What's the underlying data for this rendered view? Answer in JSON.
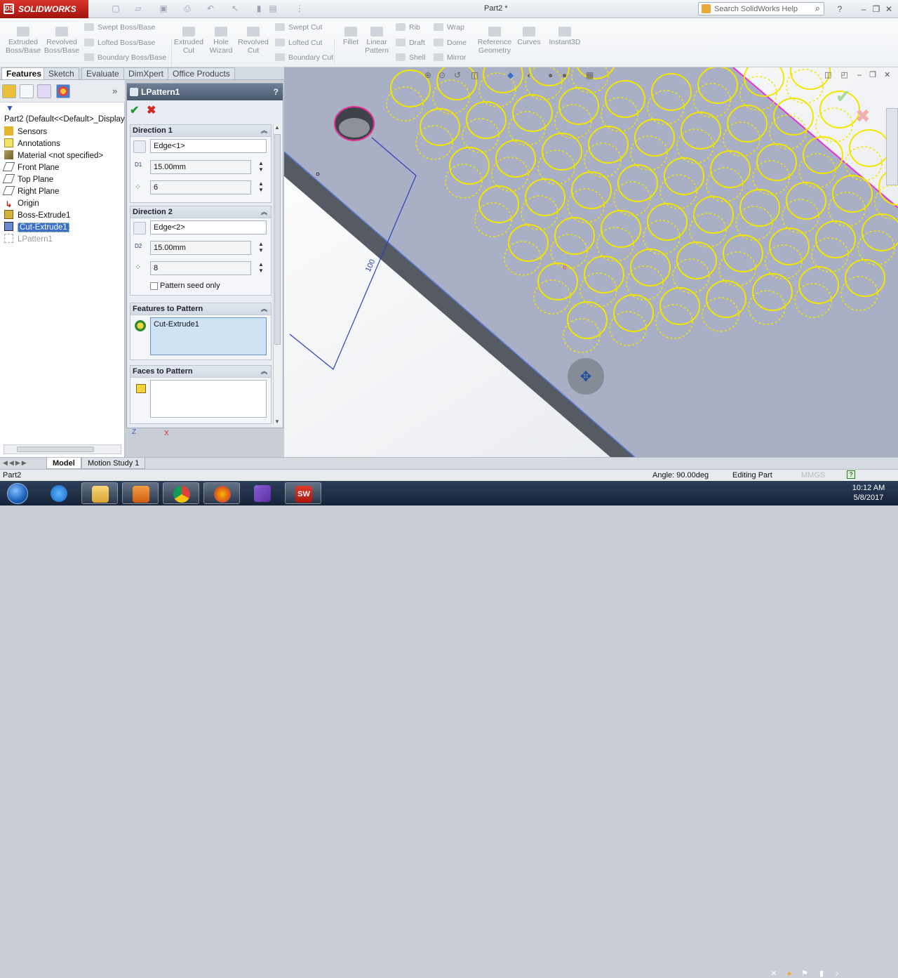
{
  "app": {
    "name": "SOLIDWORKS",
    "doc_title": "Part2 *",
    "search_placeholder": "Search SolidWorks Help"
  },
  "ribbon": {
    "big_buttons": [
      {
        "label1": "Extruded",
        "label2": "Boss/Base"
      },
      {
        "label1": "Revolved",
        "label2": "Boss/Base"
      },
      {
        "label1": "Extruded",
        "label2": "Cut"
      },
      {
        "label1": "Hole",
        "label2": "Wizard"
      },
      {
        "label1": "Revolved",
        "label2": "Cut"
      },
      {
        "label1": "Fillet",
        "label2": ""
      },
      {
        "label1": "Linear",
        "label2": "Pattern"
      },
      {
        "label1": "Reference",
        "label2": "Geometry"
      },
      {
        "label1": "Curves",
        "label2": ""
      },
      {
        "label1": "Instant3D",
        "label2": ""
      }
    ],
    "small_buttons": [
      "Swept Boss/Base",
      "Lofted Boss/Base",
      "Boundary Boss/Base",
      "Swept Cut",
      "Lofted Cut",
      "Boundary Cut",
      "Rib",
      "Draft",
      "Shell",
      "Wrap",
      "Dome",
      "Mirror"
    ]
  },
  "tabs": [
    "Features",
    "Sketch",
    "Evaluate",
    "DimXpert",
    "Office Products"
  ],
  "tree": {
    "root": "Part2  (Default<<Default>_Display",
    "items": [
      "Sensors",
      "Annotations",
      "Material <not specified>",
      "Front Plane",
      "Top Plane",
      "Right Plane",
      "Origin",
      "Boss-Extrude1",
      "Cut-Extrude1",
      "LPattern1"
    ]
  },
  "pm": {
    "title": "LPattern1",
    "help": "?",
    "direction1": {
      "heading": "Direction 1",
      "edge": "Edge<1>",
      "spacing": "15.00mm",
      "instances": "6"
    },
    "direction2": {
      "heading": "Direction 2",
      "edge": "Edge<2>",
      "spacing": "15.00mm",
      "instances": "8",
      "seed_only": "Pattern seed only"
    },
    "features": {
      "heading": "Features to Pattern",
      "item": "Cut-Extrude1"
    },
    "faces": {
      "heading": "Faces to Pattern"
    },
    "d1_label": "D1",
    "d2_label": "D2"
  },
  "viewport": {
    "dim_text": "100",
    "triad_z": "Z",
    "triad_x": "X"
  },
  "model_tabs": [
    "Model",
    "Motion Study 1"
  ],
  "status": {
    "left": "Part2",
    "angle": "Angle: 90.00deg",
    "mode": "Editing Part",
    "units": "MMGS",
    "help": "?"
  },
  "clock": {
    "time": "10:12 AM",
    "date": "5/8/2017"
  },
  "colors": {
    "pattern_yellow": "#f2e600",
    "seed_magenta": "#e6309a",
    "plate": "#a9afc4",
    "edge": "#555a63"
  }
}
